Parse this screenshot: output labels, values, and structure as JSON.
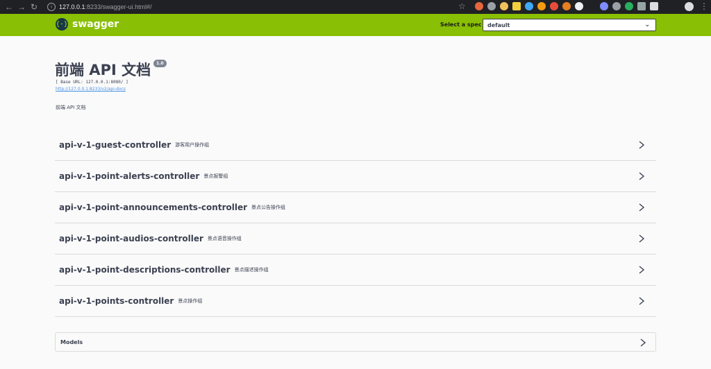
{
  "browser": {
    "url_host": "127.0.0.1",
    "url_path": ":8233/swagger-ui.html#/"
  },
  "topbar": {
    "logo_icon": "{-}",
    "logo_text": "swagger",
    "spec_label": "Select a spec",
    "spec_value": "default"
  },
  "info": {
    "title": "前端 API 文档",
    "version": "1.0",
    "base_url": "[ Base URL: 127.0.0.1:8080/ ]",
    "api_docs_link": "http://127.0.0.1:8233/v2/api-docs",
    "description": "前端 API 文档"
  },
  "tags": [
    {
      "name": "api-v-1-guest-controller",
      "description": "游客用户操作组"
    },
    {
      "name": "api-v-1-point-alerts-controller",
      "description": "景点报警组"
    },
    {
      "name": "api-v-1-point-announcements-controller",
      "description": "景点公告操作组"
    },
    {
      "name": "api-v-1-point-audios-controller",
      "description": "景点语音操作组"
    },
    {
      "name": "api-v-1-point-descriptions-controller",
      "description": "景点描述操作组"
    },
    {
      "name": "api-v-1-points-controller",
      "description": "景点操作组"
    }
  ],
  "models": {
    "label": "Models"
  },
  "colors": {
    "topbar": "#89bf04",
    "text": "#3b4151",
    "link": "#4990e2"
  }
}
